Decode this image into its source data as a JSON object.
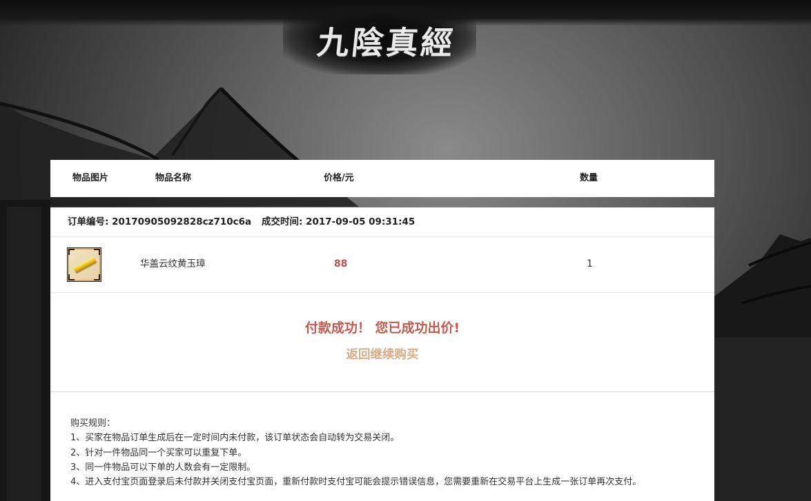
{
  "logo": {
    "text": "九陰真經"
  },
  "table_header": {
    "col_image": "物品图片",
    "col_name": "物品名称",
    "col_price": "价格/元",
    "col_qty": "数量"
  },
  "order": {
    "number_label": "订单编号:",
    "number_value": "20170905092828cz710c6a",
    "time_label": "成交时间:",
    "time_value": "2017-09-05 09:31:45"
  },
  "item": {
    "name": "华盖云纹黄玉璋",
    "price": "88",
    "quantity": "1",
    "thumbnail_icon": "jade-tablet-icon"
  },
  "result": {
    "success_message": "付款成功！ 您已成功出价!",
    "back_link": "返回继续购买"
  },
  "rules": {
    "title": "购买规则：",
    "items": [
      "1、买家在物品订单生成后在一定时间内未付款，该订单状态会自动转为交易关闭。",
      "2、针对一件物品同一个买家可以重复下单。",
      "3、同一件物品可以下单的人数会有一定限制。",
      "4、进入支付宝页面登录后未付款并关闭支付宝页面，重新付款时支付宝可能会提示错误信息，您需要重新在交易平台上生成一张订单再次支付。"
    ]
  },
  "colors": {
    "price": "#c0504f",
    "success": "#c45a4e",
    "back_link": "#d9ac86"
  }
}
